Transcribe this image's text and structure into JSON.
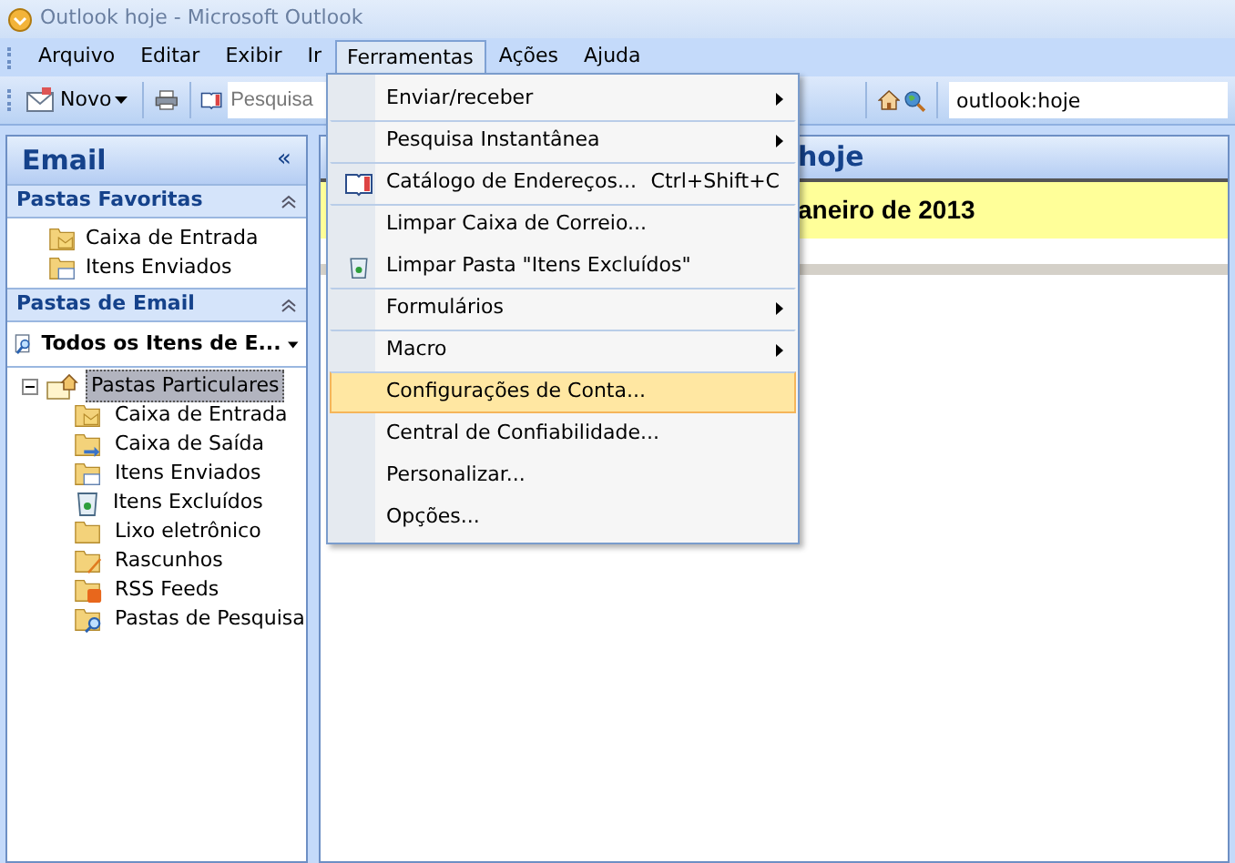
{
  "window": {
    "title": "Outlook hoje - Microsoft Outlook"
  },
  "menu_bar": [
    {
      "label": "Arquivo",
      "selected": false
    },
    {
      "label": "Editar",
      "selected": false
    },
    {
      "label": "Exibir",
      "selected": false
    },
    {
      "label": "Ir",
      "selected": false
    },
    {
      "label": "Ferramentas",
      "selected": true
    },
    {
      "label": "Ações",
      "selected": false
    },
    {
      "label": "Ajuda",
      "selected": false
    }
  ],
  "toolbar": {
    "new_button": "Novo",
    "search_field": {
      "placeholder": "Pesquisa"
    },
    "address_field": {
      "value": "outlook:hoje"
    }
  },
  "sidebar": {
    "title": "Email",
    "collapse_glyph": "«",
    "favorites": {
      "title": "Pastas Favoritas",
      "items": [
        {
          "label": "Caixa de Entrada",
          "kind": "inbox"
        },
        {
          "label": "Itens Enviados",
          "kind": "sent"
        }
      ]
    },
    "mail_folders": {
      "title": "Pastas de Email",
      "view_selector": "Todos os Itens de E...",
      "tree": [
        {
          "label": "Pastas Particulares",
          "kind": "root",
          "expanded": true,
          "selected": true,
          "children": [
            {
              "label": "Caixa de Entrada",
              "kind": "inbox",
              "selected": false
            },
            {
              "label": "Caixa de Saída",
              "kind": "outbox",
              "selected": false
            },
            {
              "label": "Itens Enviados",
              "kind": "sent",
              "selected": false
            },
            {
              "label": "Itens Excluídos",
              "kind": "deleted",
              "selected": false
            },
            {
              "label": "Lixo eletrônico",
              "kind": "junk",
              "selected": false
            },
            {
              "label": "Rascunhos",
              "kind": "drafts",
              "selected": false
            },
            {
              "label": "RSS Feeds",
              "kind": "rss",
              "selected": false
            },
            {
              "label": "Pastas de Pesquisa",
              "kind": "search",
              "selected": false
            }
          ]
        }
      ]
    }
  },
  "content": {
    "header": "hoje",
    "date_banner": "aneiro de 2013"
  },
  "dropdown_menu": [
    {
      "label": "Enviar/receber",
      "kind": "submenu",
      "separator_before": false,
      "selected": false
    },
    {
      "label": "Pesquisa Instantânea",
      "kind": "submenu",
      "separator_before": true,
      "selected": false
    },
    {
      "label": "Catálogo de Endereços...",
      "kind": "book",
      "shortcut": "Ctrl+Shift+C",
      "separator_before": true,
      "selected": false
    },
    {
      "label": "Limpar Caixa de Correio...",
      "kind": "plain",
      "separator_before": true,
      "selected": false
    },
    {
      "label": "Limpar Pasta \"Itens Excluídos\"",
      "kind": "bin",
      "separator_before": false,
      "selected": false
    },
    {
      "label": "Formulários",
      "kind": "submenu",
      "separator_before": true,
      "selected": false
    },
    {
      "label": "Macro",
      "kind": "submenu",
      "separator_before": true,
      "selected": false
    },
    {
      "label": "Configurações de Conta...",
      "kind": "plain",
      "separator_before": true,
      "selected": true
    },
    {
      "label": "Central de Confiabilidade...",
      "kind": "plain",
      "separator_before": false,
      "selected": false
    },
    {
      "label": "Personalizar...",
      "kind": "plain",
      "separator_before": false,
      "selected": false
    },
    {
      "label": "Opções...",
      "kind": "plain",
      "separator_before": false,
      "selected": false
    }
  ]
}
